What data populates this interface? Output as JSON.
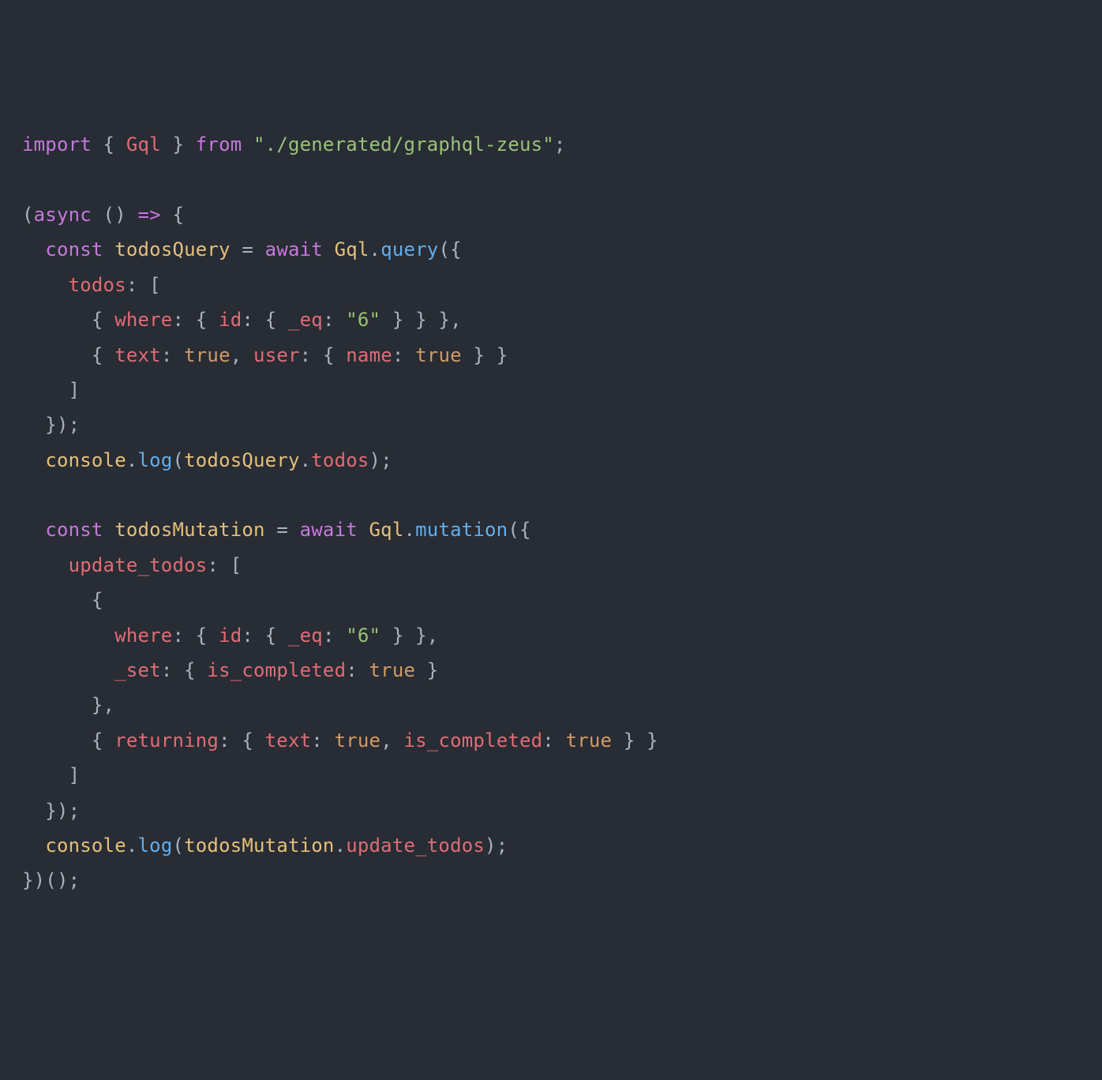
{
  "code": {
    "tokens": [
      [
        [
          "kw",
          "import"
        ],
        [
          "pun",
          " { "
        ],
        [
          "id",
          "Gql"
        ],
        [
          "pun",
          " } "
        ],
        [
          "kw",
          "from"
        ],
        [
          "pun",
          " "
        ],
        [
          "str",
          "\"./generated/graphql-zeus\""
        ],
        [
          "pun",
          ";"
        ]
      ],
      [
        [
          "pun",
          ""
        ]
      ],
      [
        [
          "pun",
          "("
        ],
        [
          "kw",
          "async"
        ],
        [
          "pun",
          " () "
        ],
        [
          "kw",
          "=>"
        ],
        [
          "pun",
          " {"
        ]
      ],
      [
        [
          "pun",
          "  "
        ],
        [
          "kw",
          "const"
        ],
        [
          "pun",
          " "
        ],
        [
          "cls",
          "todosQuery"
        ],
        [
          "pun",
          " = "
        ],
        [
          "kw",
          "await"
        ],
        [
          "pun",
          " "
        ],
        [
          "cls",
          "Gql"
        ],
        [
          "pun",
          "."
        ],
        [
          "fn",
          "query"
        ],
        [
          "pun",
          "({"
        ]
      ],
      [
        [
          "pun",
          "    "
        ],
        [
          "id",
          "todos"
        ],
        [
          "pun",
          ": ["
        ]
      ],
      [
        [
          "pun",
          "      { "
        ],
        [
          "id",
          "where"
        ],
        [
          "pun",
          ": { "
        ],
        [
          "id",
          "id"
        ],
        [
          "pun",
          ": { "
        ],
        [
          "id",
          "_eq"
        ],
        [
          "pun",
          ": "
        ],
        [
          "str",
          "\"6\""
        ],
        [
          "pun",
          " } } },"
        ]
      ],
      [
        [
          "pun",
          "      { "
        ],
        [
          "id",
          "text"
        ],
        [
          "pun",
          ": "
        ],
        [
          "num",
          "true"
        ],
        [
          "pun",
          ", "
        ],
        [
          "id",
          "user"
        ],
        [
          "pun",
          ": { "
        ],
        [
          "id",
          "name"
        ],
        [
          "pun",
          ": "
        ],
        [
          "num",
          "true"
        ],
        [
          "pun",
          " } }"
        ]
      ],
      [
        [
          "pun",
          "    ]"
        ]
      ],
      [
        [
          "pun",
          "  });"
        ]
      ],
      [
        [
          "pun",
          "  "
        ],
        [
          "cls",
          "console"
        ],
        [
          "pun",
          "."
        ],
        [
          "fn",
          "log"
        ],
        [
          "pun",
          "("
        ],
        [
          "cls",
          "todosQuery"
        ],
        [
          "pun",
          "."
        ],
        [
          "id",
          "todos"
        ],
        [
          "pun",
          ");"
        ]
      ],
      [
        [
          "pun",
          ""
        ]
      ],
      [
        [
          "pun",
          "  "
        ],
        [
          "kw",
          "const"
        ],
        [
          "pun",
          " "
        ],
        [
          "cls",
          "todosMutation"
        ],
        [
          "pun",
          " = "
        ],
        [
          "kw",
          "await"
        ],
        [
          "pun",
          " "
        ],
        [
          "cls",
          "Gql"
        ],
        [
          "pun",
          "."
        ],
        [
          "fn",
          "mutation"
        ],
        [
          "pun",
          "({"
        ]
      ],
      [
        [
          "pun",
          "    "
        ],
        [
          "id",
          "update_todos"
        ],
        [
          "pun",
          ": ["
        ]
      ],
      [
        [
          "pun",
          "      {"
        ]
      ],
      [
        [
          "pun",
          "        "
        ],
        [
          "id",
          "where"
        ],
        [
          "pun",
          ": { "
        ],
        [
          "id",
          "id"
        ],
        [
          "pun",
          ": { "
        ],
        [
          "id",
          "_eq"
        ],
        [
          "pun",
          ": "
        ],
        [
          "str",
          "\"6\""
        ],
        [
          "pun",
          " } },"
        ]
      ],
      [
        [
          "pun",
          "        "
        ],
        [
          "id",
          "_set"
        ],
        [
          "pun",
          ": { "
        ],
        [
          "id",
          "is_completed"
        ],
        [
          "pun",
          ": "
        ],
        [
          "num",
          "true"
        ],
        [
          "pun",
          " }"
        ]
      ],
      [
        [
          "pun",
          "      },"
        ]
      ],
      [
        [
          "pun",
          "      { "
        ],
        [
          "id",
          "returning"
        ],
        [
          "pun",
          ": { "
        ],
        [
          "id",
          "text"
        ],
        [
          "pun",
          ": "
        ],
        [
          "num",
          "true"
        ],
        [
          "pun",
          ", "
        ],
        [
          "id",
          "is_completed"
        ],
        [
          "pun",
          ": "
        ],
        [
          "num",
          "true"
        ],
        [
          "pun",
          " } }"
        ]
      ],
      [
        [
          "pun",
          "    ]"
        ]
      ],
      [
        [
          "pun",
          "  });"
        ]
      ],
      [
        [
          "pun",
          "  "
        ],
        [
          "cls",
          "console"
        ],
        [
          "pun",
          "."
        ],
        [
          "fn",
          "log"
        ],
        [
          "pun",
          "("
        ],
        [
          "cls",
          "todosMutation"
        ],
        [
          "pun",
          "."
        ],
        [
          "id",
          "update_todos"
        ],
        [
          "pun",
          ");"
        ]
      ],
      [
        [
          "pun",
          "})();"
        ]
      ]
    ]
  }
}
